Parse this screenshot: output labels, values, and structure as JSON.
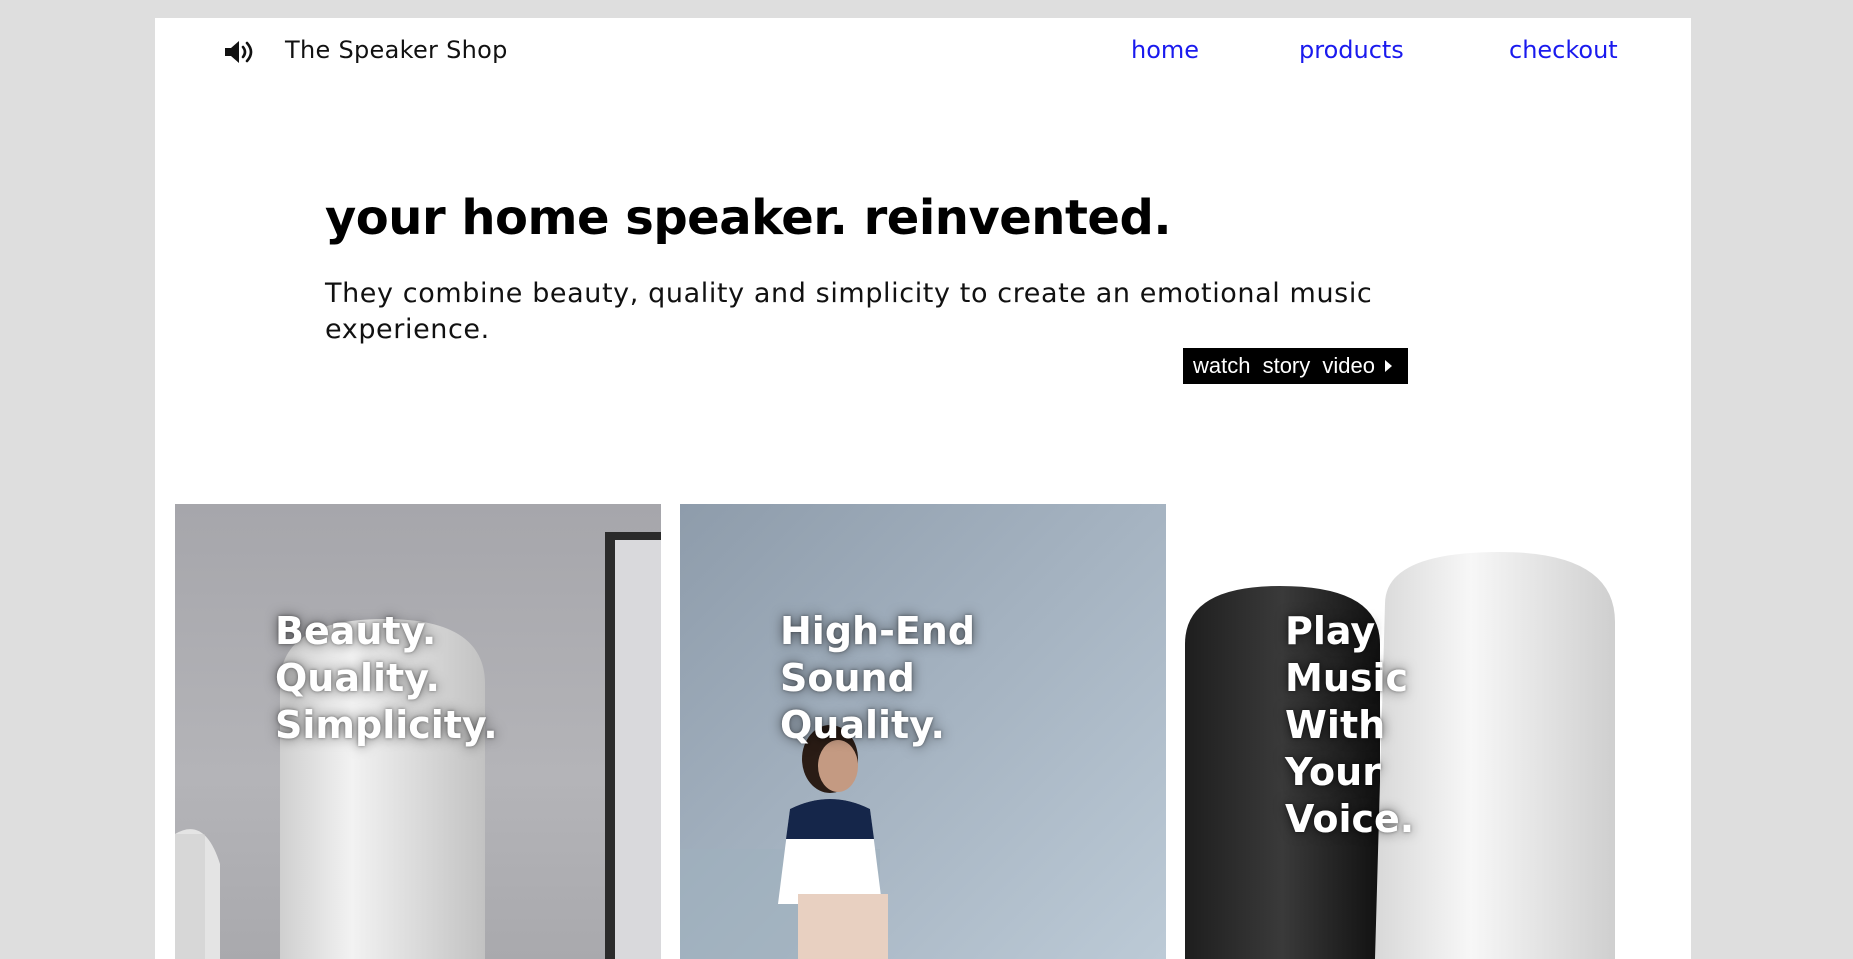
{
  "header": {
    "brand": "The Speaker Shop",
    "logo_icon": "speaker-volume-icon",
    "nav": [
      {
        "label": "home"
      },
      {
        "label": "products"
      },
      {
        "label": "checkout"
      }
    ],
    "link_color": "#1a1aee"
  },
  "hero": {
    "title": "your home speaker. reinvented.",
    "subtitle": "They combine beauty, quality and simplicity to create an emotional music experience.",
    "cta_label": "watch story video",
    "cta_icon": "play-triangle-icon"
  },
  "cards": [
    {
      "lines": [
        "Beauty.",
        "Quality.",
        "Simplicity."
      ]
    },
    {
      "lines": [
        "High-End",
        "Sound",
        "Quality."
      ]
    },
    {
      "lines": [
        "Play",
        "Music",
        "With",
        "Your",
        "Voice."
      ]
    }
  ]
}
